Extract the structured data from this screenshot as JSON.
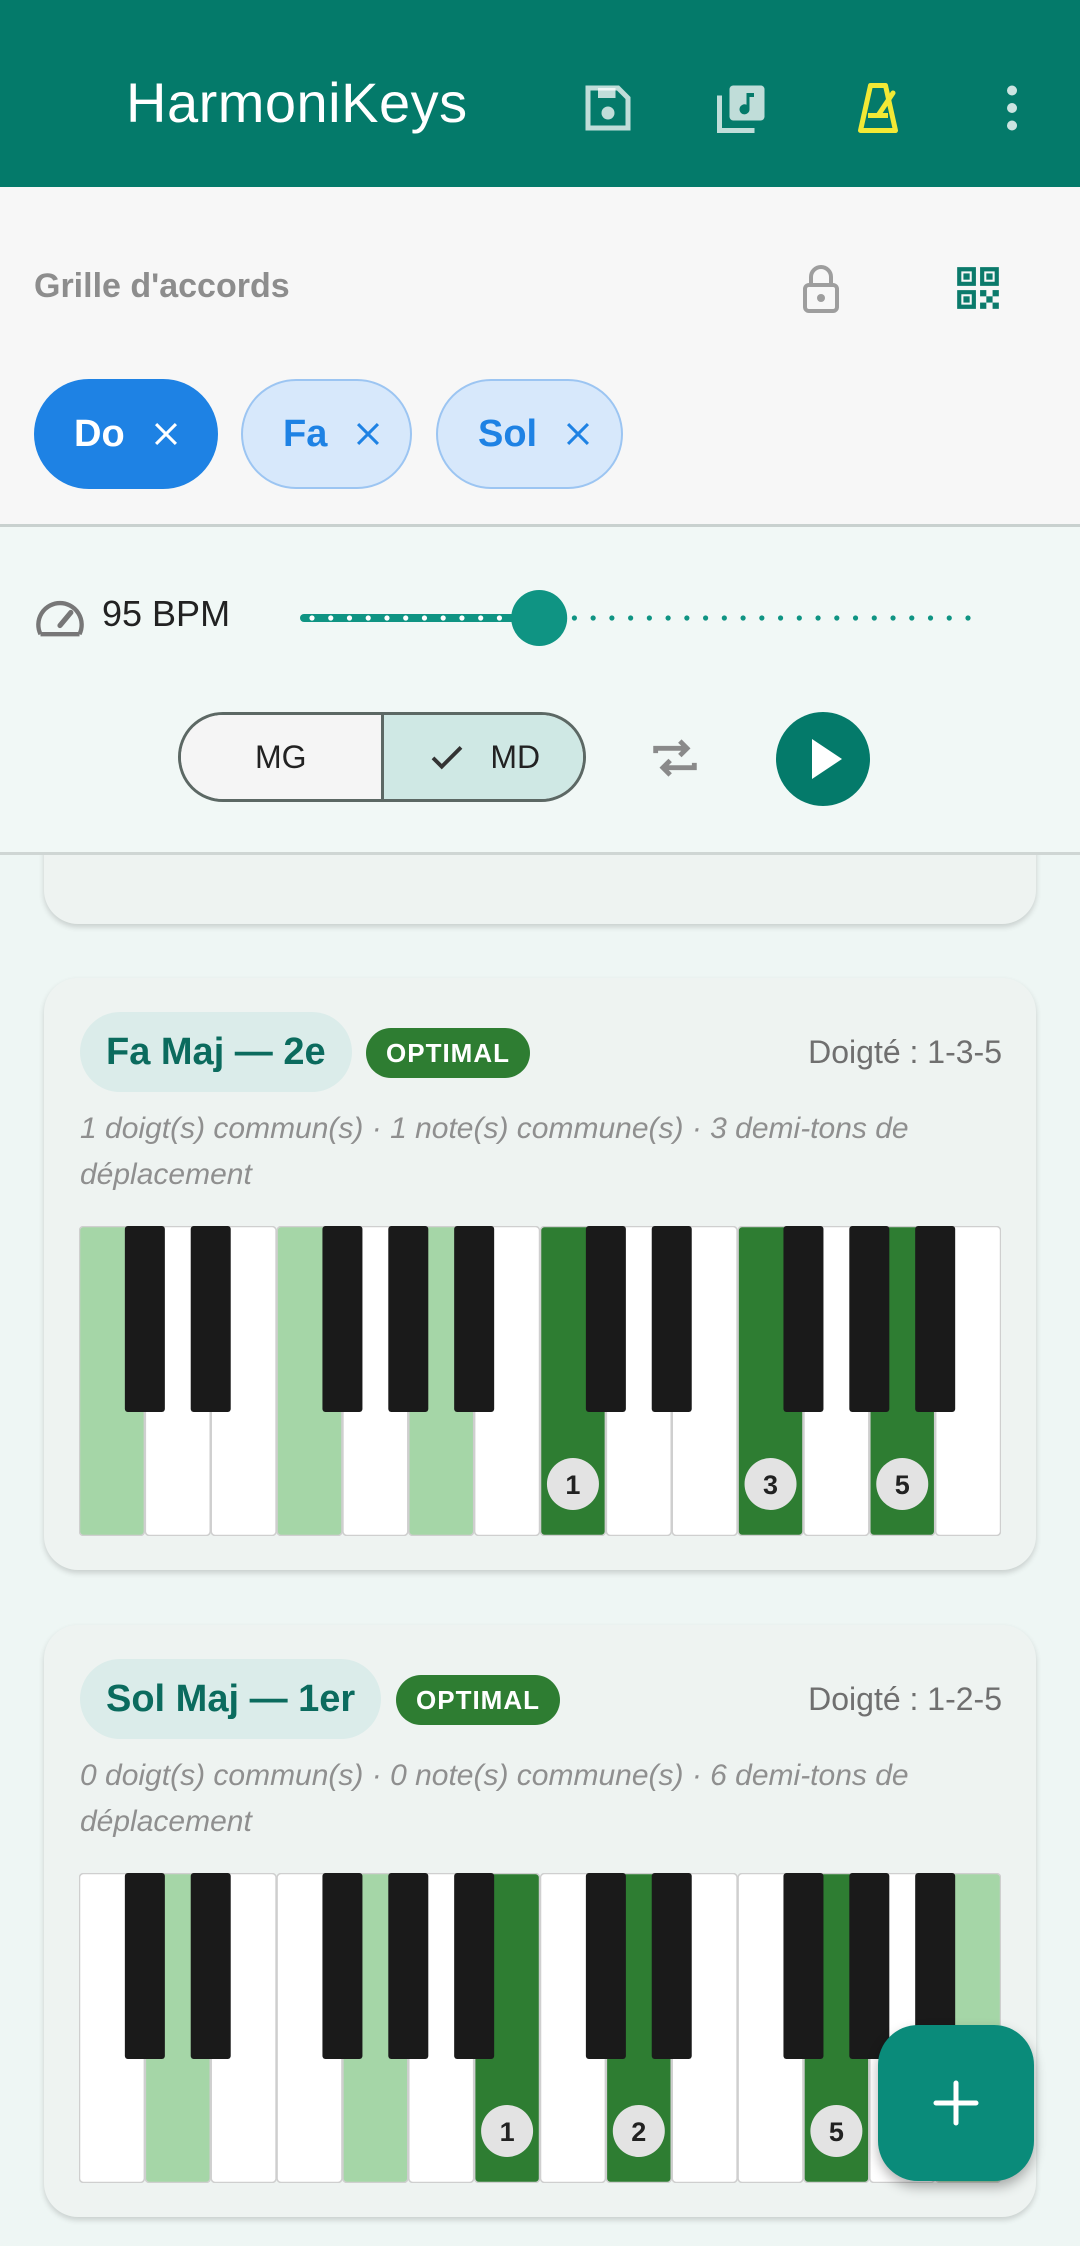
{
  "app": {
    "title": "HarmoniKeys"
  },
  "toolbar": {
    "icons": [
      "save-icon",
      "music-library-icon",
      "metronome-icon",
      "more-vert-icon"
    ],
    "metronome_color": "#f2e935"
  },
  "chord_grid": {
    "label": "Grille d'accords",
    "chips": [
      {
        "label": "Do",
        "active": true
      },
      {
        "label": "Fa",
        "active": false
      },
      {
        "label": "Sol",
        "active": false
      }
    ]
  },
  "controls": {
    "bpm_label": "95 BPM",
    "tempo_fraction": 0.35,
    "hand_options": [
      {
        "label": "MG",
        "selected": false
      },
      {
        "label": "MD",
        "selected": true
      }
    ]
  },
  "cards": [
    {
      "name": "Fa Maj — 2e",
      "badge": "OPTIMAL",
      "fingering": "Doigté : 1-3-5",
      "desc": "1 doigt(s) commun(s) · 1 note(s) commune(s) · 3 demi-tons de déplacement",
      "light_keys": [
        0,
        3,
        5
      ],
      "dark_keys": [
        7,
        10,
        12
      ],
      "finger_labels": [
        "1",
        "3",
        "5"
      ]
    },
    {
      "name": "Sol Maj — 1er",
      "badge": "OPTIMAL",
      "fingering": "Doigté : 1-2-5",
      "desc": "0 doigt(s) commun(s) · 0 note(s) commune(s) · 6 demi-tons de déplacement",
      "light_keys": [
        1,
        4,
        13
      ],
      "dark_keys": [
        6,
        8,
        11
      ],
      "finger_labels": [
        "1",
        "2",
        "5"
      ]
    }
  ],
  "colors": {
    "primary": "#047a6a",
    "chip_blue": "#1e82e4",
    "key_dark_green": "#2e7d32",
    "key_light_green": "#a5d6a7"
  }
}
